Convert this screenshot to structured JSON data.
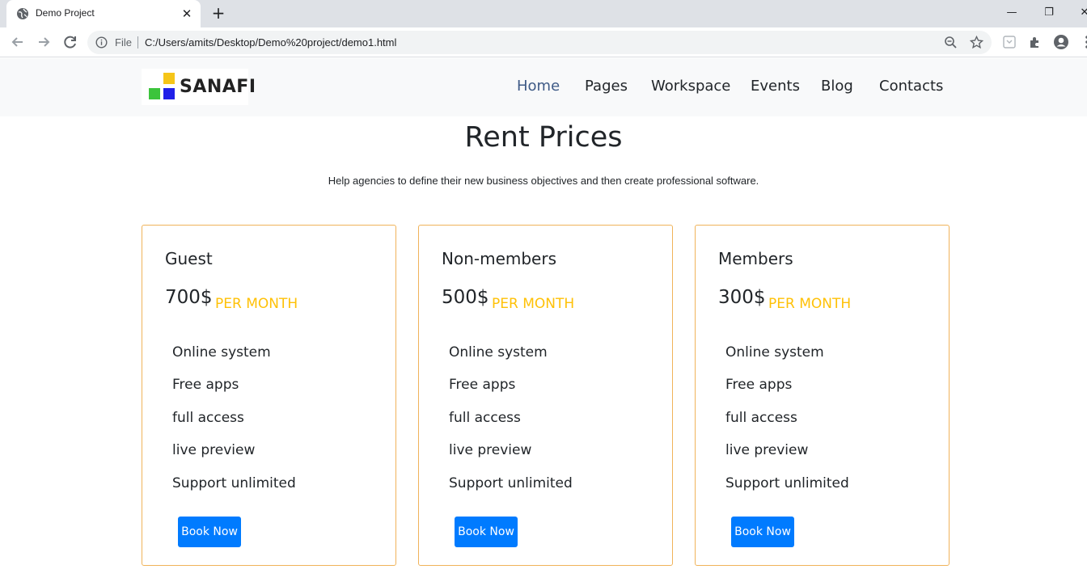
{
  "browser": {
    "tab_title": "Demo Project",
    "close_glyph": "✕",
    "new_tab_glyph": "+",
    "file_label": "File",
    "url": "C:/Users/amits/Desktop/Demo%20project/demo1.html",
    "window_controls": {
      "minimize": "—",
      "restore": "❐",
      "close": "✕"
    },
    "icons": [
      "globe-icon",
      "back-icon",
      "forward-icon",
      "reload-icon",
      "info-icon",
      "zoom-icon",
      "star-icon",
      "reading-list-icon",
      "extensions-icon",
      "profile-icon",
      "menu-icon"
    ]
  },
  "site": {
    "logo_text": "SANAFI",
    "logo_colors": {
      "yellow": "#f5c518",
      "green": "#3cc43c",
      "blue": "#2020e8"
    },
    "nav": [
      {
        "label": "Home",
        "active": true
      },
      {
        "label": "Pages",
        "active": false
      },
      {
        "label": "Workspace",
        "active": false
      },
      {
        "label": "Events",
        "active": false
      },
      {
        "label": "Blog",
        "active": false
      },
      {
        "label": "Contacts",
        "active": false
      }
    ]
  },
  "pricing": {
    "title": "Rent Prices",
    "subtitle": "Help agencies to define their new business objectives and then create professional software.",
    "plans": [
      {
        "name": "Guest",
        "price": "700$",
        "period": "PER MONTH",
        "features": [
          "Online system",
          "Free apps",
          "full access",
          "live preview",
          "Support unlimited"
        ],
        "button": "Book Now"
      },
      {
        "name": "Non-members",
        "price": "500$",
        "period": "PER MONTH",
        "features": [
          "Online system",
          "Free apps",
          "full access",
          "live preview",
          "Support unlimited"
        ],
        "button": "Book Now"
      },
      {
        "name": "Members",
        "price": "300$",
        "period": "PER MONTH",
        "features": [
          "Online system",
          "Free apps",
          "full access",
          "live preview",
          "Support unlimited"
        ],
        "button": "Book Now"
      }
    ]
  },
  "colors": {
    "accent": "#007bff",
    "period": "#ffc107",
    "card_border": "#f0b35a",
    "nav_active": "#3e5a86"
  }
}
